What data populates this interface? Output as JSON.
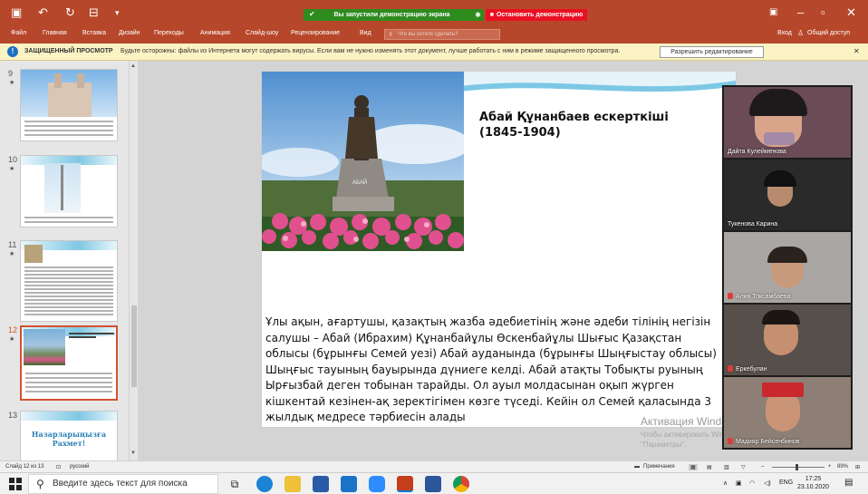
{
  "titlebar": {
    "share_message": "Вы запустили демонстрацию экрана",
    "stop_label": "Остановить демонстрацию"
  },
  "ribbon": {
    "tabs": [
      "Файл",
      "Главная",
      "Вставка",
      "Дизайн",
      "Переходы",
      "Анимация",
      "Слайд-шоу",
      "Рецензирование",
      "Вид"
    ],
    "tellme_placeholder": "Что вы хотите сделать?",
    "signin": "Вход",
    "share": "Общий доступ"
  },
  "protected_view": {
    "title": "ЗАЩИЩЕННЫЙ ПРОСМОТР",
    "message": "Будьте осторожны: файлы из Интернета могут содержать вирусы. Если вам не нужно изменять этот документ, лучше работать с ним в режиме защищенного просмотра.",
    "enable_button": "Разрешить редактирование"
  },
  "thumbnails": [
    {
      "num": "9"
    },
    {
      "num": "10"
    },
    {
      "num": "11",
      "title": "Абай Құнанбаев ескерткіші (1845-1904)"
    },
    {
      "num": "12",
      "title": "Абай Құнанбаев ескерткіші (1845-1904)"
    },
    {
      "num": "13",
      "title": "Назарларыңызға Рахмет!"
    }
  ],
  "slide": {
    "title": "Абай Құнанбаев ескерткіші (1845-1904)",
    "monument_label": "АБАЙ",
    "body": "Ұлы ақын, ағартушы, қазақтың жазба әдебиетінің және әдеби тілінің негізін салушы – Абай (Ибрахим) Құнанбайұлы Өскенбайұлы Шығыс Қазақстан облысы (бұрынғы Семей уезі) Абай ауданында (бұрынғы Шыңғыстау облысы) Шыңғыс тауының бауырында дүниеге келді. Абай атақты Тобықты руының Ырғызбай деген тобынан тарайды. Ол ауыл молдасынан оқып жүрген кішкентай кезінен-ақ зеректігімен көзге түседі. Кейін ол Семей қаласында 3 жылдық медресе тәрбиесін алады"
  },
  "activation": {
    "title": "Активация Windows",
    "subtitle": "Чтобы активировать Windows, перейдите в раздел \"Параметры\"."
  },
  "participants": [
    {
      "name": "Дайта Кулейменова",
      "muted": false,
      "bg": "#6a4b56"
    },
    {
      "name": "Тукенова Карина",
      "muted": false,
      "bg": "#2b2a2a"
    },
    {
      "name": "Алия Токсамбаева",
      "muted": true,
      "bg": "#a9a6a3"
    },
    {
      "name": "Еркебулан",
      "muted": true,
      "bg": "#57504a"
    },
    {
      "name": "Мадияр Бейсенбинов",
      "muted": true,
      "bg": "#8d7f75"
    }
  ],
  "statusbar": {
    "slide_info": "Слайд 12 из 13",
    "language": "русский",
    "notes": "Примечания",
    "zoom": "89%"
  },
  "taskbar": {
    "search_placeholder": "Введите здесь текст для поиска",
    "lang": "ENG",
    "time": "17:25",
    "date": "23.10.2020"
  }
}
